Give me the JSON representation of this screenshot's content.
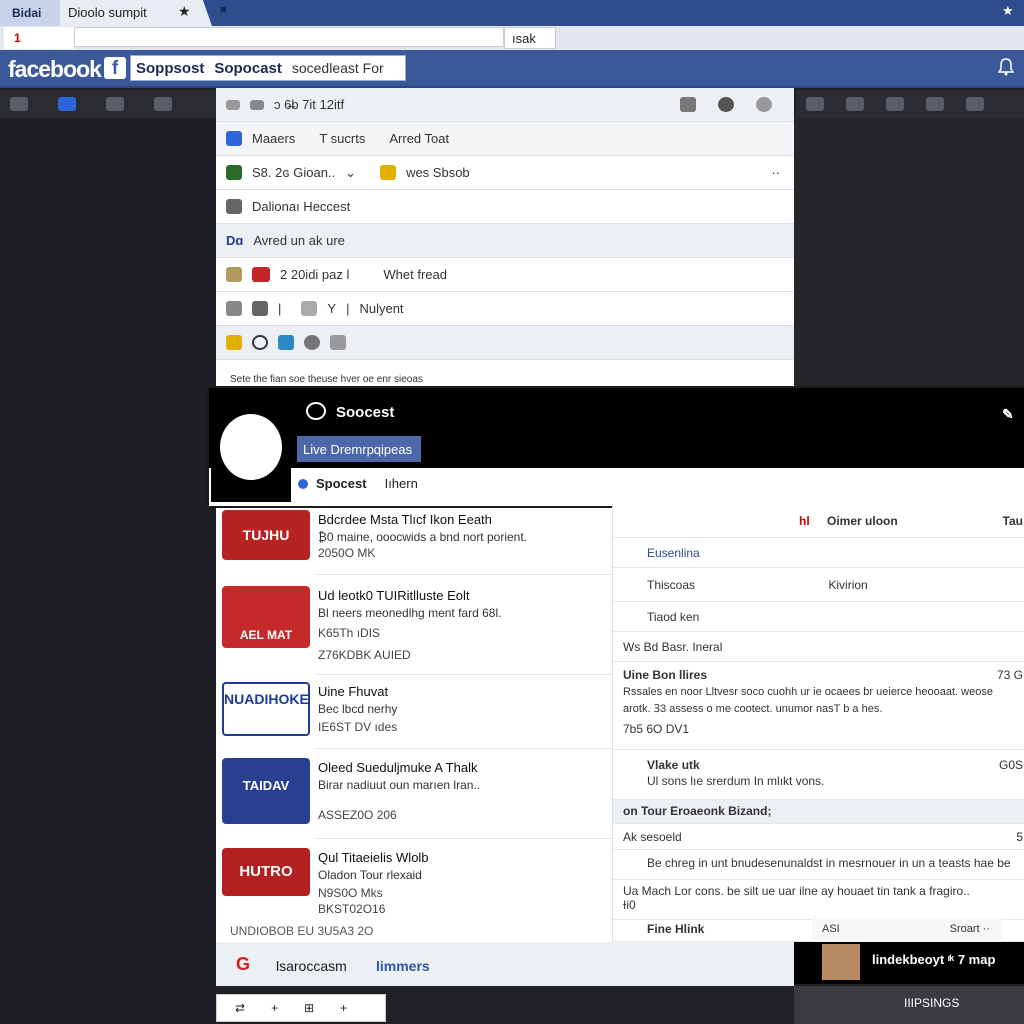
{
  "browser": {
    "tab_first": "Bidai",
    "tab_active": "Dioolo sumpit",
    "tab_star": "★",
    "tab_pin": "■",
    "corner_star": "★",
    "address_left": "1",
    "address_url": "",
    "address_button": "ısak"
  },
  "facebook": {
    "logo": "facebook",
    "mark": "f",
    "search_tokens": [
      "Soppsost",
      "Sopocast"
    ],
    "search_query": "socedleast For",
    "header_icon": "bell-icon"
  },
  "center_panel": {
    "toolbar_text": "ɔ 6̶b 7it 12itf",
    "tabs": [
      "Maaers",
      "T sucrts",
      "Arred Toat"
    ],
    "row_status": {
      "left": "S8. 2ɢ Gioan..",
      "right": "wes Sbsob",
      "right_more": "··"
    },
    "row_heading": "Dalionaı Heccest",
    "row_section": {
      "badge": "Dɑ",
      "text": "Avred un ak ure"
    },
    "row_meta": {
      "count": "2 20idi paz l",
      "label": "Whet fread"
    },
    "row_tools": "Nulyent",
    "caption": "Sete the fian soe theuse hver oe enr sieoas"
  },
  "card": {
    "title": "Soocest",
    "live_button": "Live Dremrpqipeas",
    "nav": [
      "Spocest",
      "Iıhern"
    ],
    "close": "✎"
  },
  "feed_items": [
    {
      "title": "Bdcrdee Msta Tlıcf Ikon Eeath",
      "desc": "₿0 maine, ooocwids a bnd nort porient.",
      "meta": "2050O MK",
      "thumb_color": "#b52323",
      "thumb_text": "TUJHU"
    },
    {
      "title": "Ud leotk0 TUIRitlluste Eolt",
      "desc": "Bl neers meonedlhg ment fard 68l.",
      "meta": "K65Th ıDIS",
      "meta2": "Z76KDBK AUIED",
      "thumb_color": "#c52a2a",
      "thumb_text": "AEL MAT"
    },
    {
      "title": "Uine Fhuvat",
      "desc": "Bec lbcd nerhy",
      "meta": "IE6ST DV ıdes",
      "thumb_color": "#1e3a9a",
      "thumb_text": "NUADIHOKE"
    },
    {
      "title": "Oleed Sueduljmuke A Thalk",
      "desc": "Birar nadiuut oun marıen lran..",
      "meta": "ASSEZ0O 206",
      "thumb_color": "#2a3f8f",
      "thumb_text": "TAIDAV"
    },
    {
      "title": "Qul Titaeielis Wlolb",
      "desc": "Oladon Tour rlexaid",
      "meta": "N9S0O Mks",
      "meta2": "BKST02O16",
      "thumb_color": "#b32020",
      "thumb_text": "HUTRO"
    }
  ],
  "feed_footer": "UNDIOBOB EU 3U5A3 2O",
  "right_column": [
    {
      "label": "Oimer uloon",
      "extra": "Tau",
      "prefix": "hl"
    },
    {
      "label": "Eusenlina"
    },
    {
      "label": "Thiscoas",
      "extra": "Kivirion"
    },
    {
      "label": "Tiaod ken"
    },
    {
      "label": "Ws Bd Basr. Ineral"
    },
    {
      "label": "Uine Bon llires",
      "extra": "73 G",
      "body": "Rssales en noor Lltvesr soco cuohh ur ie ocaees br ueierce heooaat. weose arotk. Ɜ3 assess o me cootect. unumor nasT b a hes.",
      "meta": "7b5 6O DV1"
    },
    {
      "label": "Vlake utk",
      "extra": "G0S",
      "body": "Ul sons lıe srerdum In mlıkt vons."
    },
    {
      "label": "on Tour Eroaeonk Bizand;"
    },
    {
      "label": "Ak sesoeld",
      "extra": "5"
    },
    {
      "label": "Be chreg in unt bnudesenunaldst in mesrnouer in un a teasts hae be"
    },
    {
      "label": "Ua Mach Lor cons. be silt ue uar ilne ay houaet tin tank a fragiro..",
      "meta": "Ɨi0"
    },
    {
      "label": "Fine Hlink"
    }
  ],
  "promo": {
    "label": "ASI",
    "right": "Sroart  ··"
  },
  "bottom": {
    "logo": "G",
    "text_left": "lsaroccasm",
    "text_right": "limmers",
    "tools": [
      "⇄",
      "+",
      "⊞",
      "+"
    ],
    "person_label": "lindekbeoyt ᶦᵏ 7 map",
    "right_label": "IIIPSINGS"
  },
  "colors": {
    "fb_blue": "#3b5998",
    "accent_red": "#d42020",
    "dark_bg": "#1f2126"
  }
}
